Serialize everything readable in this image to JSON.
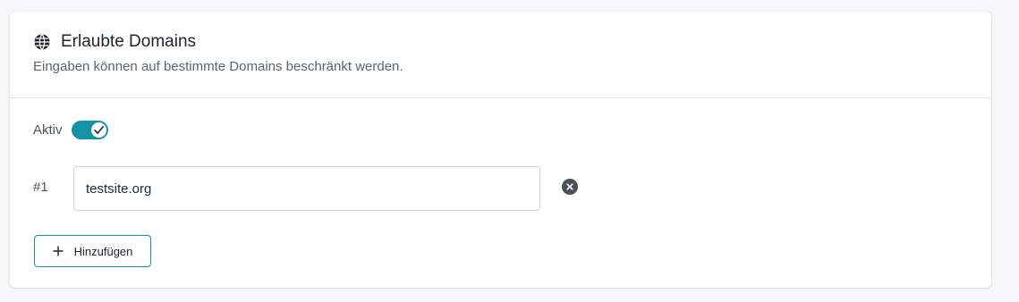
{
  "section": {
    "title": "Erlaubte Domains",
    "subtitle": "Eingaben können auf bestimmte Domains beschränkt werden.",
    "icon": "globe-icon"
  },
  "active": {
    "label": "Aktiv",
    "enabled": true,
    "accent_color": "#1592a6"
  },
  "domains": [
    {
      "index_label": "#1",
      "value": "testsite.org"
    }
  ],
  "add_button": {
    "label": "Hinzufügen",
    "icon": "plus-icon"
  }
}
